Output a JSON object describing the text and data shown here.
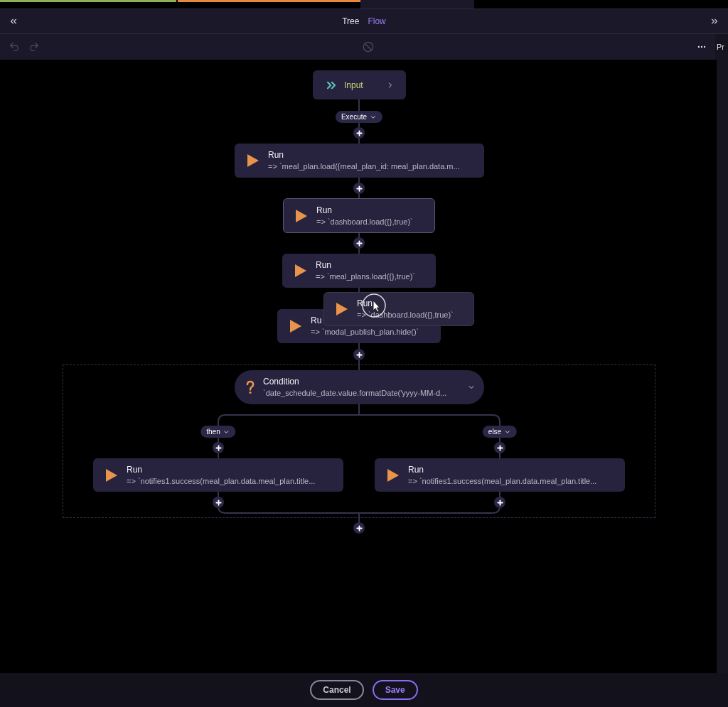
{
  "tabs": [
    {
      "label": "Tree",
      "selected": false
    },
    {
      "label": "Flow",
      "selected": true
    }
  ],
  "side_panel": {
    "label": "Pr"
  },
  "flow": {
    "trigger": "Execute",
    "nodes": [
      {
        "kind": "input",
        "title": "Input"
      },
      {
        "kind": "run",
        "title": "Run",
        "code": "=> `meal_plan.load({meal_plan_id: meal_plan.data.m...",
        "selected": false
      },
      {
        "kind": "run",
        "title": "Run",
        "code": "=> `dashboard.load({},true)`",
        "selected": true
      },
      {
        "kind": "run",
        "title": "Run",
        "code": "=> `meal_plans.load({},true)`",
        "selected": false
      },
      {
        "kind": "run",
        "title": "Ru",
        "code": "=> `modal_publish_plan.hide()`",
        "selected": false
      },
      {
        "kind": "condition",
        "title": "Condition",
        "code": "`date_schedule_date.value.formatDate('yyyy-MM-d..."
      },
      {
        "kind": "run",
        "title": "Run",
        "code": "=> `notifies1.success(meal_plan.data.meal_plan.title...",
        "selected": false
      },
      {
        "kind": "run",
        "title": "Run",
        "code": "=> `notifies1.success(meal_plan.data.meal_plan.title...",
        "selected": false
      }
    ],
    "branches": [
      {
        "label": "then"
      },
      {
        "label": "else"
      }
    ],
    "dragging": {
      "title": "Run",
      "code": "=> `dashboard.load({},true)`"
    }
  },
  "buttons": [
    {
      "label": "Cancel",
      "kind": "secondary"
    },
    {
      "label": "Save",
      "kind": "primary"
    }
  ]
}
